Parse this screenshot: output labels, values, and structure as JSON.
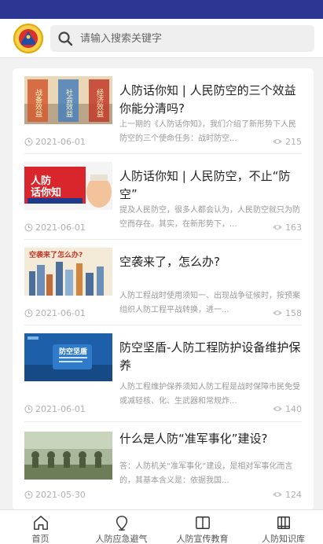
{
  "search": {
    "placeholder": "请输入搜索关键字"
  },
  "articles": [
    {
      "title": "人防话你知 | 人民防空的三个效益你能分清吗?",
      "summary": "上一期的《人防话你知》，我们介绍了新形势下人民防空的三个使命任务：战时防空...",
      "date": "2021-06-01",
      "views": "215",
      "thumb_texts": [
        "战备效益",
        "社会效益",
        "经济效益"
      ]
    },
    {
      "title": "人防话你知 | 人民防空，不止“防空”",
      "summary": "提及人民防空，很多人都会认为，人民防空就只为防空而存在。其实，在新形势下，...",
      "date": "2021-06-01",
      "views": "163",
      "thumb_texts": [
        "人防",
        "话你知"
      ]
    },
    {
      "title": "空袭来了，怎么办?",
      "summary": "人防工程战时使用须知一、出现战争征候时，按预案组织人防工程平战转换，进一...",
      "date": "2021-06-01",
      "views": "158",
      "thumb_texts": [
        "空袭来了怎么办?"
      ]
    },
    {
      "title": "防空坚盾-人防工程防护设备维护保养",
      "summary": "人防工程维护保养须知人防工程是战时保障市民免受或减轻核、化、生武器和常规炸...",
      "date": "2021-06-01",
      "views": "140",
      "thumb_texts": [
        "防空坚盾"
      ]
    },
    {
      "title": "什么是人防“准军事化”建设?",
      "summary": "答：人防机关“准军事化”建设，是相对军事化而言的，其基本含义是：依据我国...",
      "date": "2021-05-30",
      "views": "124",
      "thumb_texts": []
    }
  ],
  "tabs": [
    {
      "label": "首页",
      "icon": "home-icon"
    },
    {
      "label": "人防应急避气",
      "icon": "location-pin-icon"
    },
    {
      "label": "人防宣传教育",
      "icon": "book-icon"
    },
    {
      "label": "人防知识库",
      "icon": "library-icon"
    }
  ],
  "colors": {
    "statusbar": "#2c3794",
    "title_text": "#222222",
    "muted_text": "#9a9a9a"
  }
}
